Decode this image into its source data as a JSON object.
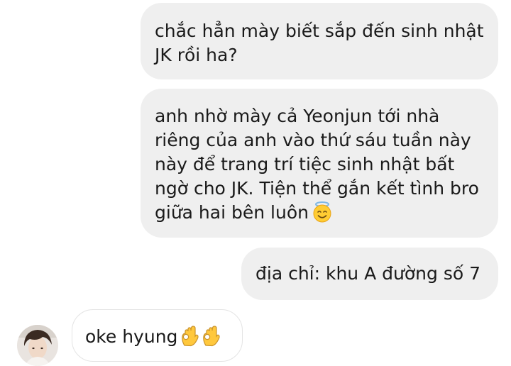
{
  "messages": [
    {
      "direction": "sent",
      "text": "chắc hẳn mày biết sắp đến sinh nhật JK rồi ha?"
    },
    {
      "direction": "sent",
      "text": "anh nhờ mày cả Yeonjun tới nhà riêng của anh vào thứ sáu tuần này này để trang trí tiệc sinh nhật bất ngờ cho JK. Tiện thể gắn kết tình bro giữa hai bên luôn",
      "emoji": "smiling-face-with-halo"
    },
    {
      "direction": "sent",
      "text": "địa chỉ: khu A đường số 7"
    },
    {
      "direction": "received",
      "text": "oke hyung",
      "emoji": [
        "ok-hand",
        "ok-hand"
      ]
    }
  ],
  "colors": {
    "sent_bubble": "#efefef",
    "received_border": "#e4e4e4",
    "text": "#1a1a1a"
  }
}
